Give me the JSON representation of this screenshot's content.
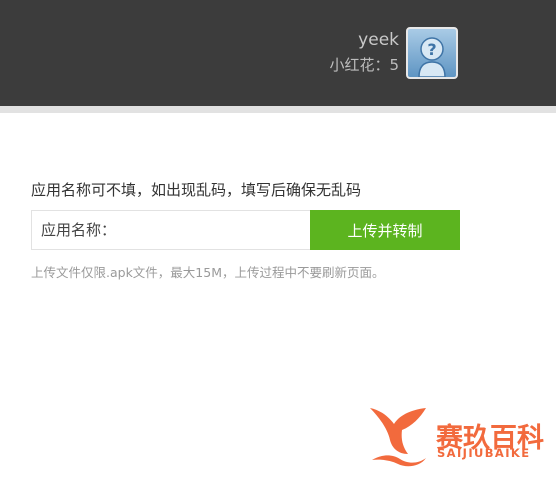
{
  "header": {
    "username": "yeek",
    "points_text": "小红花：5",
    "avatar_icon": "question-avatar-icon"
  },
  "form": {
    "instruction": "应用名称可不填，如出现乱码，填写后确保无乱码",
    "app_name_placeholder": "应用名称：",
    "app_name_value": "",
    "upload_button_label": "上传并转制",
    "hint": "上传文件仅限.apk文件，最大15M，上传过程中不要刷新页面。"
  },
  "watermark": {
    "title": "赛玖百科",
    "subtitle": "SAIJIUBAIKE"
  },
  "colors": {
    "header_bg": "#3c3c3c",
    "accent_green": "#5cb41f",
    "watermark_orange": "#f26a3d"
  }
}
